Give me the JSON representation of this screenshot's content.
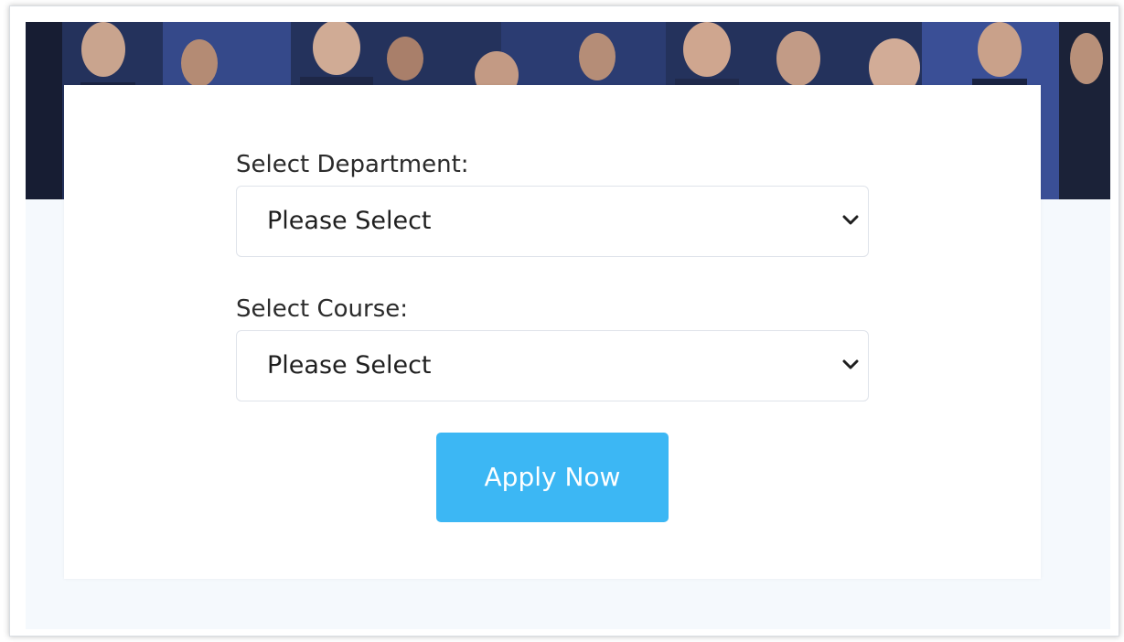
{
  "form": {
    "department_label": "Select Department:",
    "department_value": "Please Select",
    "course_label": "Select Course:",
    "course_value": "Please Select",
    "apply_label": "Apply Now"
  },
  "colors": {
    "accent_button": "#3cb7f4",
    "page_background": "#f5f9fd",
    "card_background": "#ffffff"
  },
  "icons": {
    "dropdown": "chevron-down-icon"
  }
}
